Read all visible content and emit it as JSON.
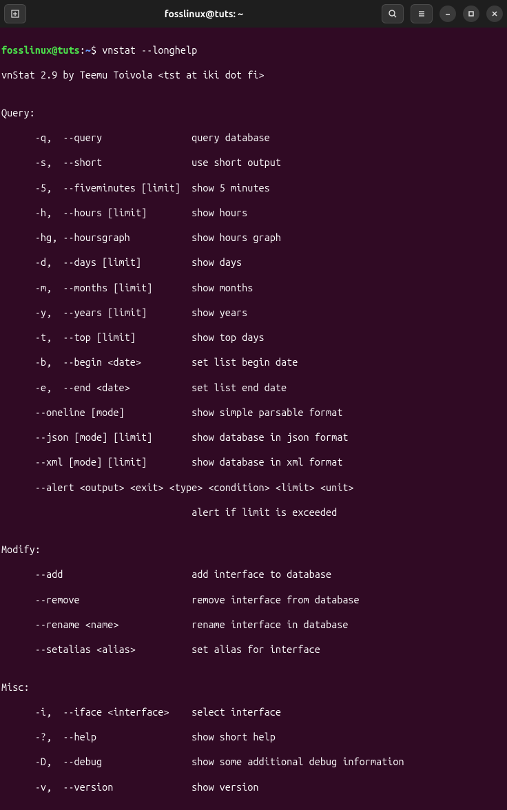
{
  "titlebar": {
    "title": "fosslinux@tuts: ~"
  },
  "prompt": {
    "user_host": "fosslinux@tuts",
    "colon": ":",
    "path": "~",
    "dollar": "$ ",
    "command": "vnstat --longhelp"
  },
  "lines": {
    "version_line": "vnStat 2.9 by Teemu Toivola <tst at iki dot fi>",
    "blank": "",
    "query_header": "Query:",
    "q1": "      -q,  --query                query database",
    "q2": "      -s,  --short                use short output",
    "q3": "      -5,  --fiveminutes [limit]  show 5 minutes",
    "q4": "      -h,  --hours [limit]        show hours",
    "q5": "      -hg, --hoursgraph           show hours graph",
    "q6": "      -d,  --days [limit]         show days",
    "q7": "      -m,  --months [limit]       show months",
    "q8": "      -y,  --years [limit]        show years",
    "q9": "      -t,  --top [limit]          show top days",
    "q10": "      -b,  --begin <date>         set list begin date",
    "q11": "      -e,  --end <date>           set list end date",
    "q12": "      --oneline [mode]            show simple parsable format",
    "q13": "      --json [mode] [limit]       show database in json format",
    "q14": "      --xml [mode] [limit]        show database in xml format",
    "q15": "      --alert <output> <exit> <type> <condition> <limit> <unit>",
    "q16": "                                  alert if limit is exceeded",
    "modify_header": "Modify:",
    "m1": "      --add                       add interface to database",
    "m2": "      --remove                    remove interface from database",
    "m3": "      --rename <name>             rename interface in database",
    "m4": "      --setalias <alias>          set alias for interface",
    "misc_header": "Misc:",
    "mi1": "      -i,  --iface <interface>    select interface",
    "mi2": "      -?,  --help                 show short help",
    "mi3": "      -D,  --debug                show some additional debug information",
    "mi4": "      -v,  --version              show version"
  }
}
